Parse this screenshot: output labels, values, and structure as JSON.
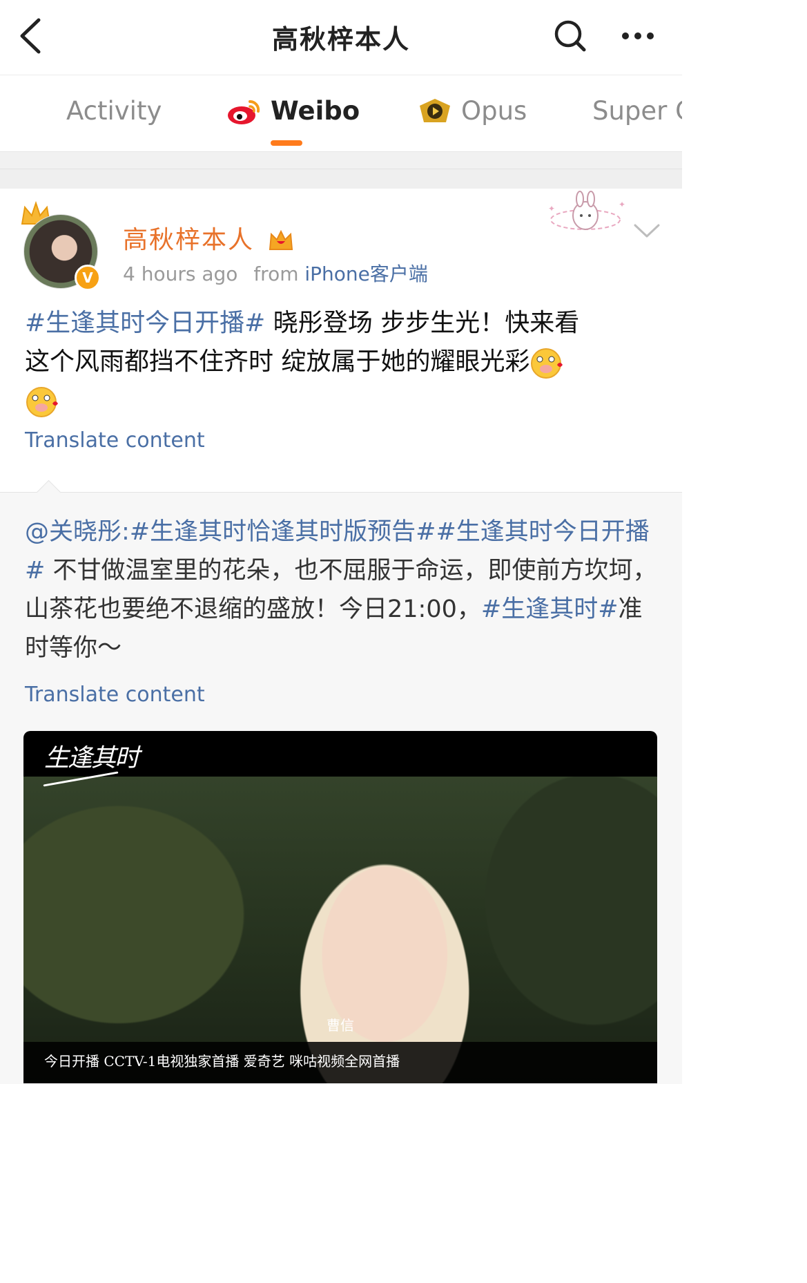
{
  "nav": {
    "title": "高秋梓本人"
  },
  "tabs": [
    {
      "label": "Activity"
    },
    {
      "label": "Weibo"
    },
    {
      "label": "Opus"
    },
    {
      "label": "Super C"
    }
  ],
  "post": {
    "username": "高秋梓本人",
    "time": "4 hours ago",
    "from_label": "from",
    "source": "iPhone客户端",
    "hashtag": "#生逢其时今日开播#",
    "text_line1": " 晓彤登场 步步生光！快来看",
    "text_line2": "这个风雨都挡不住齐时  绽放属于她的耀眼光彩",
    "translate": "Translate content"
  },
  "repost": {
    "mention": "@关晓彤:",
    "tag1": "#生逢其时恰逢其时版预告#",
    "tag2": "#生逢其时今日开播#",
    "body": " 不甘做温室里的花朵，也不屈服于命运，即使前方坎坷，山茶花也要绝不退缩的盛放！今日21:00，",
    "tag3": "#生逢其时#",
    "tail": "准时等你～",
    "translate": "Translate content"
  },
  "video": {
    "logo_text": "生逢其时",
    "subtitle_name": "曹信",
    "caption": "今日开播 CCTV-1电视独家首播 爱奇艺 咪咕视频全网首播"
  },
  "colors": {
    "accent": "#ff7b1c",
    "link": "#4a6fa5",
    "username": "#e8722a"
  }
}
